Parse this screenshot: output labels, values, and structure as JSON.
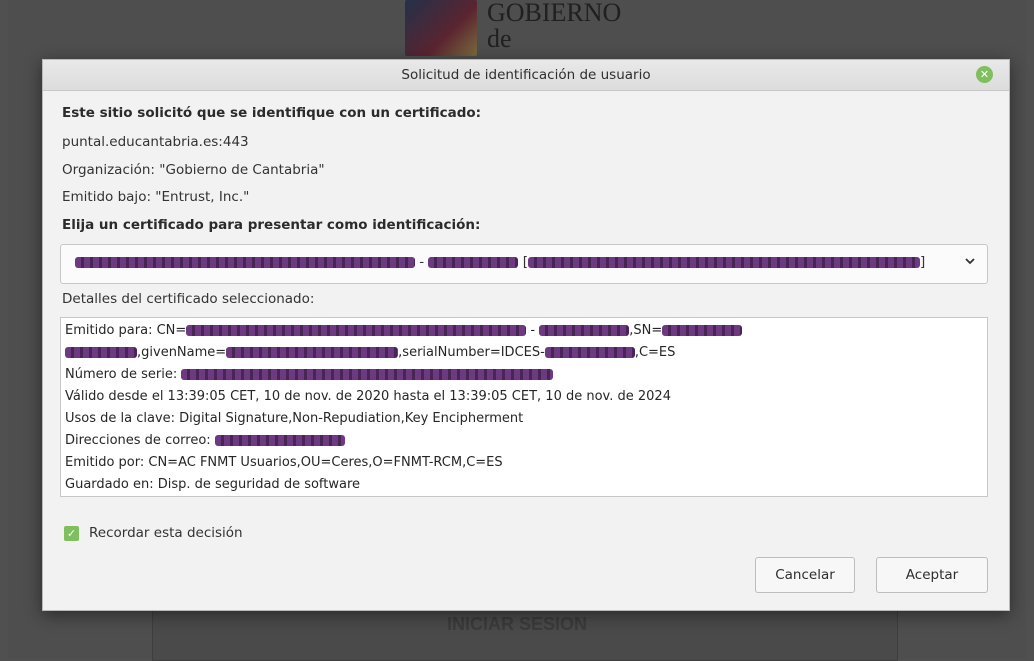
{
  "background": {
    "logo_text_line1": "GOBIERNO",
    "logo_text_line2": "de",
    "login_button": "INICIAR SESION"
  },
  "dialog": {
    "title": "Solicitud de identificación de usuario",
    "heading_site": "Este sitio solicitó que se identifique con un certificado:",
    "host": "puntal.educantabria.es:443",
    "organization": "Organización: \"Gobierno de Cantabria\"",
    "issued_under": "Emitido bajo: \"Entrust, Inc.\"",
    "heading_choose": "Elija un certificado para presentar como identificación:",
    "combo": {
      "separator": "-",
      "bracket_open": "[",
      "bracket_close": "]"
    },
    "details_label": "Detalles del certificado seleccionado:",
    "details": {
      "line1_prefix": "Emitido para: CN=",
      "line1_sep": " - ",
      "line1_sn": ",SN=",
      "line2_given": ",givenName=",
      "line2_serial": ",serialNumber=IDCES-",
      "line2_c": ",C=ES",
      "line3": "Número de serie: ",
      "line4": "Válido desde el 13:39:05 CET, 10 de nov. de 2020 hasta el 13:39:05 CET, 10 de nov. de 2024",
      "line5": "Usos de la clave: Digital Signature,Non-Repudiation,Key Encipherment",
      "line6": "Direcciones de correo: ",
      "line7": "Emitido por: CN=AC FNMT Usuarios,OU=Ceres,O=FNMT-RCM,C=ES",
      "line8": "Guardado en: Disp. de seguridad de software"
    },
    "remember_label": "Recordar esta decisión",
    "remember_checked": true,
    "cancel_label": "Cancelar",
    "accept_label": "Aceptar"
  },
  "colors": {
    "accent_green": "#7fbf5e",
    "redaction": "#5a2d6b"
  }
}
